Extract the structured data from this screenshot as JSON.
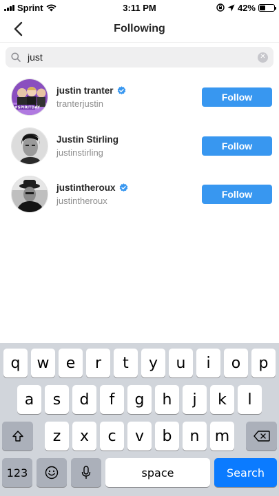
{
  "status_bar": {
    "carrier": "Sprint",
    "time": "3:11 PM",
    "battery": "42%",
    "battery_level": 0.42
  },
  "header": {
    "title": "Following",
    "back_icon": "chevron-left-icon"
  },
  "search": {
    "value": "just",
    "clear_icon": "clear-icon"
  },
  "users": [
    {
      "name": "justin tranter",
      "handle": "tranterjustin",
      "verified": true,
      "button": "Follow"
    },
    {
      "name": "Justin Stirling",
      "handle": "justinstirling",
      "verified": false,
      "button": "Follow"
    },
    {
      "name": "justintheroux",
      "handle": "justintheroux",
      "verified": true,
      "button": "Follow"
    }
  ],
  "keyboard": {
    "row1": [
      "q",
      "w",
      "e",
      "r",
      "t",
      "y",
      "u",
      "i",
      "o",
      "p"
    ],
    "row2": [
      "a",
      "s",
      "d",
      "f",
      "g",
      "h",
      "j",
      "k",
      "l"
    ],
    "row3": [
      "z",
      "x",
      "c",
      "v",
      "b",
      "n",
      "m"
    ],
    "numbers_label": "123",
    "space_label": "space",
    "search_label": "Search"
  },
  "colors": {
    "accent": "#3897f0",
    "keyboard_bg": "#d1d5db",
    "search_key": "#0b7bff"
  }
}
